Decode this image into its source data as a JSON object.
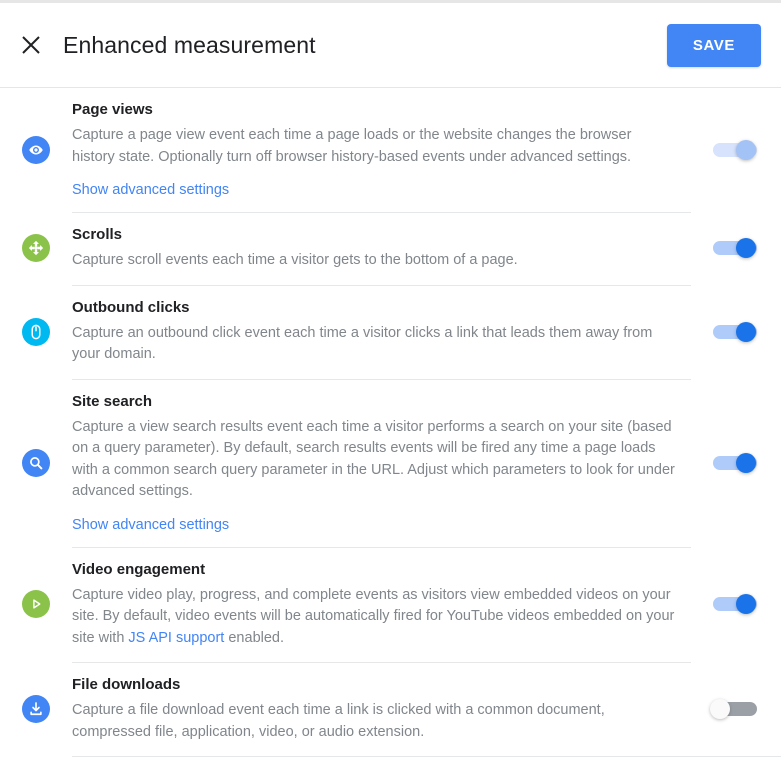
{
  "header": {
    "close_icon": "close-icon",
    "title": "Enhanced measurement",
    "save_label": "SAVE"
  },
  "colors": {
    "accent_blue": "#4285f4",
    "toggle_on": "#1a73e8",
    "toggle_track_on": "#aecbfa",
    "toggle_off": "#9aa0a6",
    "icon_green": "#8bc34a",
    "icon_cyan": "#00b9f1",
    "link": "#4285f4",
    "description_text": "#80868b",
    "title_text": "#202124"
  },
  "rows": [
    {
      "icon": "eye-icon",
      "icon_color": "#4285f4",
      "title": "Page views",
      "description": "Capture a page view event each time a page loads or the website changes the browser history state. Optionally turn off browser history-based events under advanced settings.",
      "link_label": "Show advanced settings",
      "toggle_state": "on-disabled"
    },
    {
      "icon": "scroll-compass-icon",
      "icon_color": "#8bc34a",
      "title": "Scrolls",
      "description": "Capture scroll events each time a visitor gets to the bottom of a page.",
      "link_label": "",
      "toggle_state": "on"
    },
    {
      "icon": "mouse-click-icon",
      "icon_color": "#00b9f1",
      "title": "Outbound clicks",
      "description": "Capture an outbound click event each time a visitor clicks a link that leads them away from your domain.",
      "link_label": "",
      "toggle_state": "on"
    },
    {
      "icon": "search-icon",
      "icon_color": "#4285f4",
      "title": "Site search",
      "description": "Capture a view search results event each time a visitor performs a search on your site (based on a query parameter). By default, search results events will be fired any time a page loads with a common search query parameter in the URL. Adjust which parameters to look for under advanced settings.",
      "link_label": "Show advanced settings",
      "toggle_state": "on"
    },
    {
      "icon": "play-icon",
      "icon_color": "#8bc34a",
      "title": "Video engagement",
      "description_before": "Capture video play, progress, and complete events as visitors view embedded videos on your site. By default, video events will be automatically fired for YouTube videos embedded on your site with ",
      "inline_link": "JS API support",
      "description_after": " enabled.",
      "toggle_state": "on"
    },
    {
      "icon": "download-icon",
      "icon_color": "#4285f4",
      "title": "File downloads",
      "description": "Capture a file download event each time a link is clicked with a common document, compressed file, application, video, or audio extension.",
      "link_label": "",
      "toggle_state": "off"
    }
  ]
}
